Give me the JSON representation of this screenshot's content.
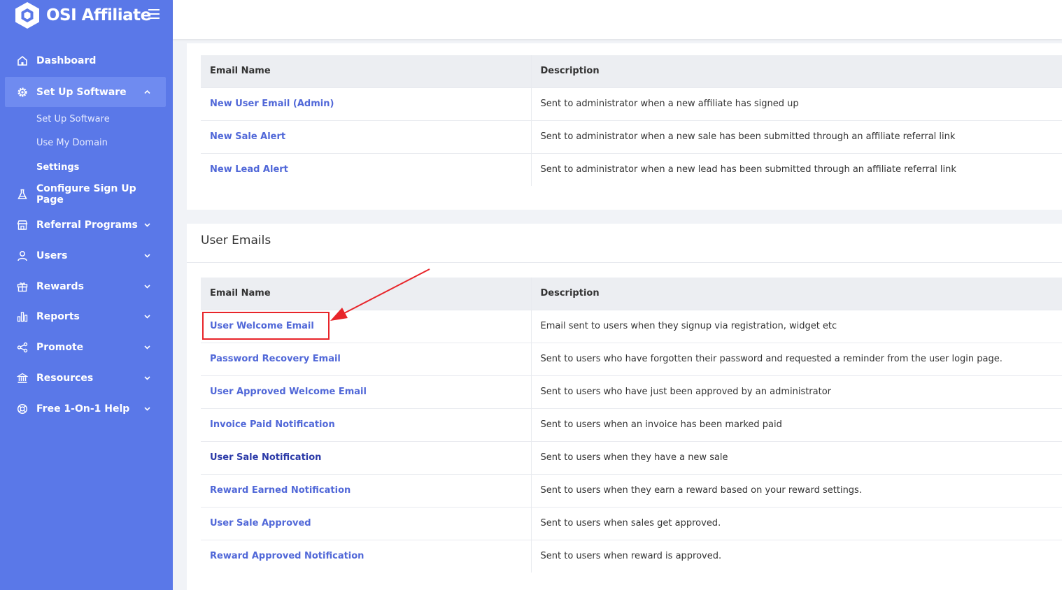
{
  "brand": {
    "name": "OSI Affiliate"
  },
  "sidebar": {
    "items": [
      {
        "label": "Dashboard",
        "icon": "home-icon"
      },
      {
        "label": "Set Up Software",
        "icon": "gear-icon",
        "expanded": true
      },
      {
        "label": "Configure Sign Up Page",
        "icon": "flask-icon"
      },
      {
        "label": "Referral Programs",
        "icon": "store-icon"
      },
      {
        "label": "Users",
        "icon": "user-icon"
      },
      {
        "label": "Rewards",
        "icon": "gift-icon"
      },
      {
        "label": "Reports",
        "icon": "bar-chart-icon"
      },
      {
        "label": "Promote",
        "icon": "share-icon"
      },
      {
        "label": "Resources",
        "icon": "bank-icon"
      },
      {
        "label": "Free 1-On-1 Help",
        "icon": "lifebuoy-icon"
      }
    ],
    "subitems": [
      {
        "label": "Set Up Software"
      },
      {
        "label": "Use My Domain"
      },
      {
        "label": "Settings"
      }
    ]
  },
  "admin_table": {
    "headers": [
      "Email Name",
      "Description"
    ],
    "rows": [
      {
        "name": "New User Email (Admin)",
        "description": "Sent to administrator when a new affiliate has signed up"
      },
      {
        "name": "New Sale Alert",
        "description": "Sent to administrator when a new sale has been submitted through an affiliate referral link"
      },
      {
        "name": "New Lead Alert",
        "description": "Sent to administrator when a new lead has been submitted through an affiliate referral link"
      }
    ]
  },
  "user_emails": {
    "title": "User Emails",
    "headers": [
      "Email Name",
      "Description"
    ],
    "rows": [
      {
        "name": "User Welcome Email",
        "description": "Email sent to users when they signup via registration, widget etc"
      },
      {
        "name": "Password Recovery Email",
        "description": "Sent to users who have forgotten their password and requested a reminder from the user login page."
      },
      {
        "name": "User Approved Welcome Email",
        "description": "Sent to users who have just been approved by an administrator"
      },
      {
        "name": "Invoice Paid Notification",
        "description": "Sent to users when an invoice has been marked paid"
      },
      {
        "name": "User Sale Notification",
        "description": "Sent to users when they have a new sale"
      },
      {
        "name": "Reward Earned Notification",
        "description": "Sent to users when they earn a reward based on your reward settings."
      },
      {
        "name": "User Sale Approved",
        "description": "Sent to users when sales get approved."
      },
      {
        "name": "Reward Approved Notification",
        "description": "Sent to users when reward is approved."
      }
    ]
  },
  "colors": {
    "sidebar": "#5a78e8",
    "link": "#5168d8",
    "highlight": "#e8252a"
  }
}
